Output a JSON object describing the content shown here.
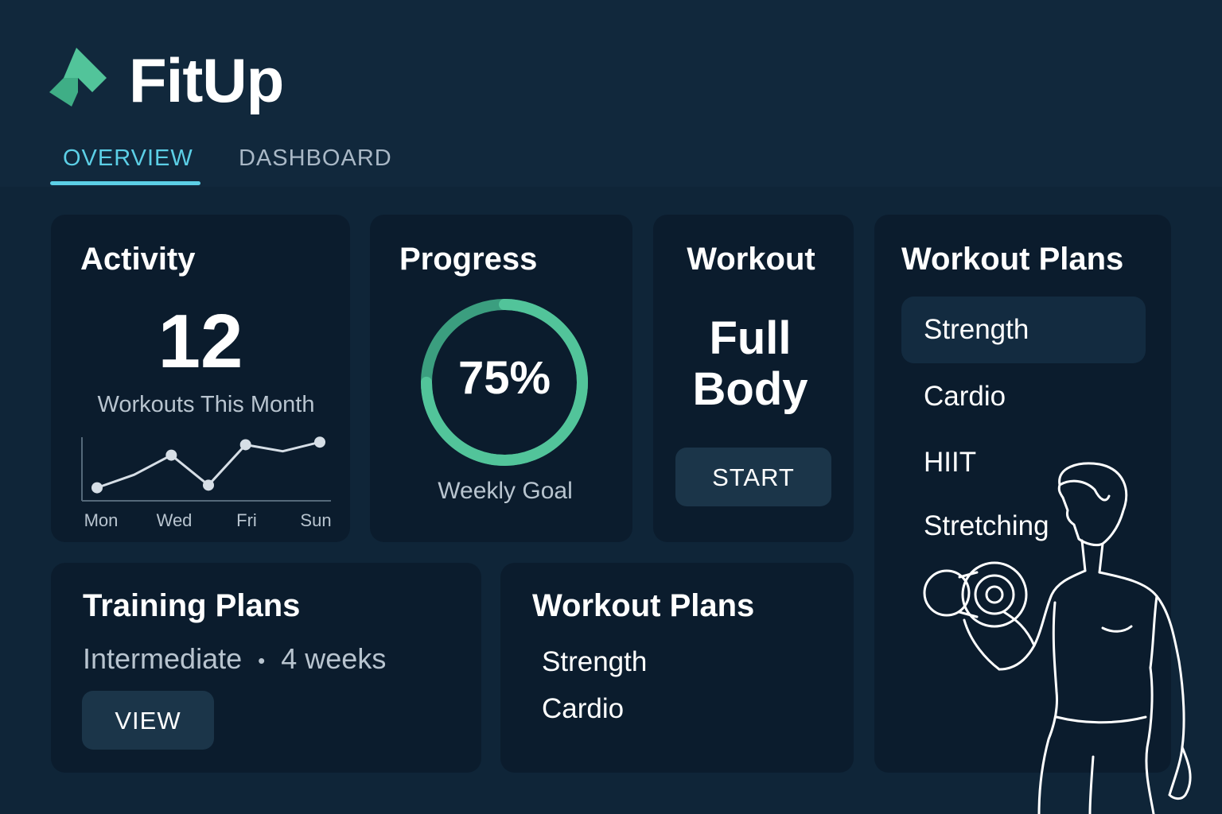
{
  "app": {
    "name": "FitUp"
  },
  "tabs": [
    {
      "label": "OVERVIEW",
      "active": true
    },
    {
      "label": "DASHBOARD",
      "active": false
    }
  ],
  "colors": {
    "background": "#0f2538",
    "card": "#0b1c2d",
    "accent": "#5ccfe6",
    "brand_green": "#52c49a",
    "button": "#1b3549"
  },
  "activity": {
    "title": "Activity",
    "count": "12",
    "subtitle": "Workouts This Month",
    "chart_labels": [
      "Mon",
      "Wed",
      "Fri",
      "Sun"
    ]
  },
  "progress": {
    "title": "Progress",
    "value": "75%",
    "fraction": 0.75,
    "subtitle": "Weekly Goal"
  },
  "workout": {
    "title": "Workout",
    "name_line1": "Full",
    "name_line2": "Body",
    "start_label": "START"
  },
  "workout_plans": {
    "title": "Workout Plans",
    "items": [
      {
        "label": "Strength",
        "active": true
      },
      {
        "label": "Cardio",
        "active": false
      },
      {
        "label": "HIIT",
        "active": false
      },
      {
        "label": "Stretching",
        "active": false
      }
    ]
  },
  "training_plans": {
    "title": "Training Plans",
    "level": "Intermediate",
    "separator": "•",
    "duration": "4 weeks",
    "view_label": "VIEW"
  },
  "workout_plans_2": {
    "title": "Workout Plans",
    "items": [
      "Strength",
      "Cardio"
    ]
  },
  "icons": {
    "logo": "fitup-logo-icon",
    "illustration": "athlete-dumbbell-icon"
  },
  "chart_data": {
    "type": "line",
    "categories": [
      "Mon",
      "",
      "Wed",
      "",
      "Fri",
      "",
      "Sun"
    ],
    "values": [
      1.0,
      2.0,
      3.5,
      1.2,
      4.3,
      3.8,
      4.5
    ],
    "title": "",
    "xlabel": "",
    "ylabel": "",
    "ylim": [
      0,
      5
    ],
    "grid": false
  }
}
